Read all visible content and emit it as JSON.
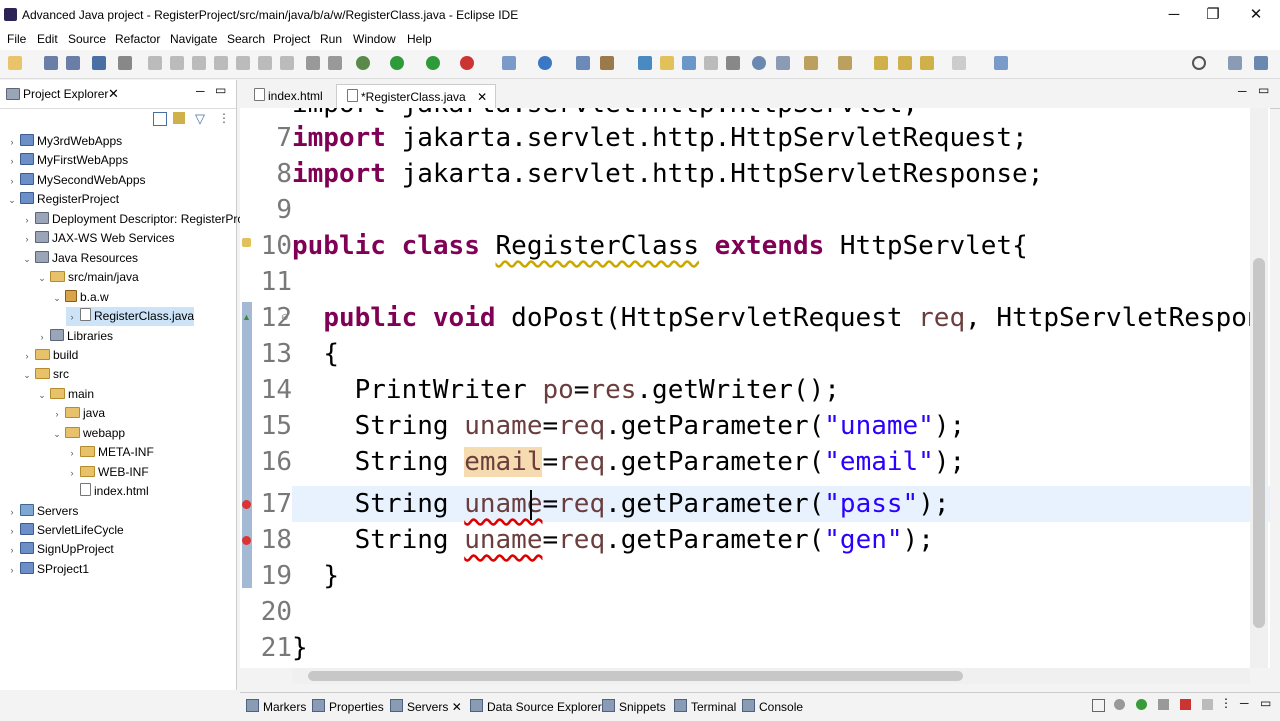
{
  "window": {
    "title": "Advanced Java project - RegisterProject/src/main/java/b/a/w/RegisterClass.java - Eclipse IDE",
    "minimize": "─",
    "maximize": "❐",
    "close": "✕"
  },
  "menu": [
    "File",
    "Edit",
    "Source",
    "Refactor",
    "Navigate",
    "Search",
    "Project",
    "Run",
    "Window",
    "Help"
  ],
  "explorer": {
    "tab_label": "Project Explorer",
    "tree": [
      {
        "label": "My3rdWebApps",
        "depth": 0,
        "twisty": "›",
        "icon": "proj"
      },
      {
        "label": "MyFirstWebApps",
        "depth": 0,
        "twisty": "›",
        "icon": "proj"
      },
      {
        "label": "MySecondWebApps",
        "depth": 0,
        "twisty": "›",
        "icon": "proj"
      },
      {
        "label": "RegisterProject",
        "depth": 0,
        "twisty": "⌄",
        "icon": "proj"
      },
      {
        "label": "Deployment Descriptor: RegisterProje",
        "depth": 1,
        "twisty": "›",
        "icon": "lib"
      },
      {
        "label": "JAX-WS Web Services",
        "depth": 1,
        "twisty": "›",
        "icon": "lib"
      },
      {
        "label": "Java Resources",
        "depth": 1,
        "twisty": "⌄",
        "icon": "lib"
      },
      {
        "label": "src/main/java",
        "depth": 2,
        "twisty": "⌄",
        "icon": "folder"
      },
      {
        "label": "b.a.w",
        "depth": 3,
        "twisty": "⌄",
        "icon": "pkg"
      },
      {
        "label": "RegisterClass.java",
        "depth": 4,
        "twisty": "›",
        "icon": "jfile",
        "selected": true
      },
      {
        "label": "Libraries",
        "depth": 2,
        "twisty": "›",
        "icon": "lib"
      },
      {
        "label": "build",
        "depth": 1,
        "twisty": "›",
        "icon": "folder"
      },
      {
        "label": "src",
        "depth": 1,
        "twisty": "⌄",
        "icon": "folder"
      },
      {
        "label": "main",
        "depth": 2,
        "twisty": "⌄",
        "icon": "folder"
      },
      {
        "label": "java",
        "depth": 3,
        "twisty": "›",
        "icon": "folder"
      },
      {
        "label": "webapp",
        "depth": 3,
        "twisty": "⌄",
        "icon": "folder"
      },
      {
        "label": "META-INF",
        "depth": 4,
        "twisty": "›",
        "icon": "folder"
      },
      {
        "label": "WEB-INF",
        "depth": 4,
        "twisty": "›",
        "icon": "folder"
      },
      {
        "label": "index.html",
        "depth": 4,
        "twisty": "",
        "icon": "jfile"
      },
      {
        "label": "Servers",
        "depth": 0,
        "twisty": "›",
        "icon": "svr"
      },
      {
        "label": "ServletLifeCycle",
        "depth": 0,
        "twisty": "›",
        "icon": "proj"
      },
      {
        "label": "SignUpProject",
        "depth": 0,
        "twisty": "›",
        "icon": "proj"
      },
      {
        "label": "SProject1",
        "depth": 0,
        "twisty": "›",
        "icon": "proj"
      }
    ]
  },
  "editor": {
    "tabs": [
      {
        "label": "index.html",
        "active": false
      },
      {
        "label": "*RegisterClass.java",
        "active": true
      }
    ],
    "partial_top": "import jakarta.servlet.http.HttpServlet;",
    "lines": [
      {
        "n": "7"
      },
      {
        "n": "8"
      },
      {
        "n": "9"
      },
      {
        "n": "10"
      },
      {
        "n": "11"
      },
      {
        "n": "12"
      },
      {
        "n": "13"
      },
      {
        "n": "14"
      },
      {
        "n": "15"
      },
      {
        "n": "16"
      },
      {
        "n": "17"
      },
      {
        "n": "18"
      },
      {
        "n": "19"
      },
      {
        "n": "20"
      },
      {
        "n": "21"
      }
    ],
    "code": {
      "l7_kw": "import",
      "l7": " jakarta.servlet.http.HttpServletRequest;",
      "l8_kw": "import",
      "l8": " jakarta.servlet.http.HttpServletResponse;",
      "l10_kw1": "public",
      "l10_kw2": "class",
      "l10_name": "RegisterClass",
      "l10_kw3": "extends",
      "l10_rest": " HttpServlet{",
      "l12_kw1": "public",
      "l12_kw2": "void",
      "l12_m": " doPost(HttpServletRequest ",
      "l12_v1": "req",
      "l12_m2": ", HttpServletRespon",
      "l13": "{",
      "l14_t": "PrintWriter ",
      "l14_v": "po",
      "l14_eq": "=",
      "l14_v2": "res",
      "l14_rest": ".getWriter();",
      "l15_t": "String ",
      "l15_v": "uname",
      "l15_eq": "=",
      "l15_v2": "req",
      "l15_m": ".getParameter(",
      "l15_s": "\"uname\"",
      "l15_e": ");",
      "l16_t": "String ",
      "l16_v": "email",
      "l16_eq": "=",
      "l16_v2": "req",
      "l16_m": ".getParameter(",
      "l16_s": "\"email\"",
      "l16_e": ");",
      "l17_t": "String ",
      "l17_v": "uname",
      "l17_eq": "=",
      "l17_v2": "req",
      "l17_m": ".getParameter(",
      "l17_s": "\"pass\"",
      "l17_e": ");",
      "l18_t": "String ",
      "l18_v": "uname",
      "l18_eq": "=",
      "l18_v2": "req",
      "l18_m": ".getParameter(",
      "l18_s": "\"gen\"",
      "l18_e": ");",
      "l19": "}",
      "l21": "}"
    }
  },
  "bottom_tabs": [
    "Markers",
    "Properties",
    "Servers",
    "Data Source Explorer",
    "Snippets",
    "Terminal",
    "Console"
  ],
  "colors": {
    "keyword": "#7f0055",
    "string": "#2a00ff",
    "variable": "#6a3e3e",
    "selection": "#cde3f7"
  }
}
